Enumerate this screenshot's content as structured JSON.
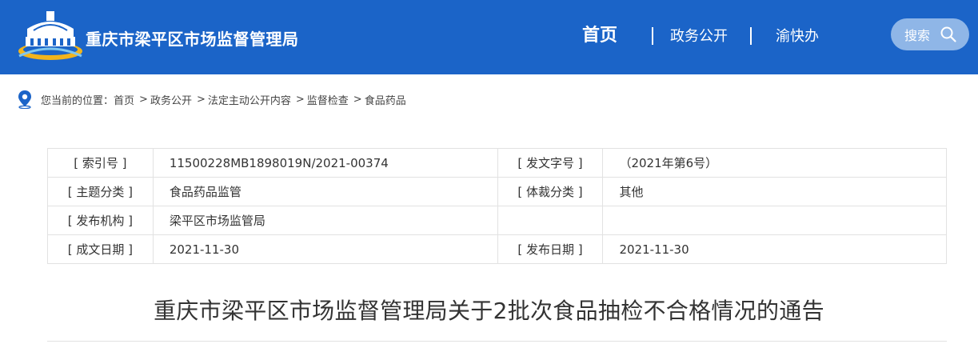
{
  "header": {
    "site_title": "重庆市梁平区市场监督管理局",
    "nav": {
      "home": "首页",
      "items": [
        "政务公开",
        "渝快办"
      ],
      "separator": "|"
    },
    "search_label": "搜索",
    "colors": {
      "bar": "#1b64c8",
      "search_bg": "#8fb6e7"
    },
    "icons": {
      "logo": "building-logo-icon",
      "search": "search-icon"
    }
  },
  "breadcrumb": {
    "prefix": "您当前的位置：",
    "items": [
      "首页",
      "政务公开",
      "法定主动公开内容",
      "监督检查",
      "食品药品"
    ],
    "separator": ">",
    "icon": "location-pin-icon"
  },
  "info": {
    "rows": [
      {
        "label1": "[ 索引号 ]",
        "value1": "11500228MB1898019N/2021-00374",
        "label2": "[ 发文字号 ]",
        "value2": "（2021年第6号）"
      },
      {
        "label1": "[ 主题分类 ]",
        "value1": "食品药品监管",
        "label2": "[ 体裁分类 ]",
        "value2": "其他"
      },
      {
        "label1": "[ 发布机构 ]",
        "value1": "梁平区市场监管局",
        "label2": "",
        "value2": ""
      },
      {
        "label1": "[ 成文日期 ]",
        "value1": "2021-11-30",
        "label2": "[ 发布日期 ]",
        "value2": "2021-11-30"
      }
    ]
  },
  "document": {
    "title": "重庆市梁平区市场监督管理局关于2批次食品抽检不合格情况的通告"
  }
}
